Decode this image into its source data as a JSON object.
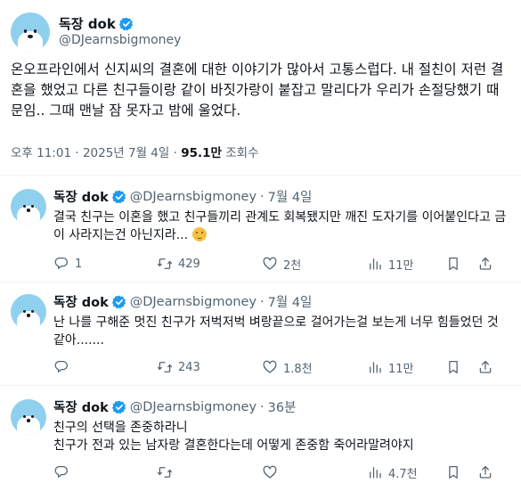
{
  "author": {
    "display_name": "독장 dok",
    "handle": "@DJearnsbigmoney"
  },
  "main_post": {
    "text": "온오프라인에서 신지씨의 결혼에 대한 이야기가 많아서 고통스럽다. 내 절친이 저런 결혼을 했었고 다른 친구들이랑 같이 바짓가랑이 붙잡고 말리다가 우리가 손절당했기 때문임.. 그때 맨날 잠 못자고 밤에 울었다.",
    "time": "오후 11:01",
    "date": "2025년 7월 4일",
    "views_count": "95.1만",
    "views_label": "조회수"
  },
  "replies": [
    {
      "name": "독장 dok",
      "handle": "@DJearnsbigmoney",
      "time": "7월 4일",
      "text": "결국 친구는 이혼을 했고 친구들끼리 관계도 회복됐지만 깨진 도자기를 이어붙인다고 금이 사라지는건 아닌지라...",
      "has_emoji": true,
      "replies": "1",
      "reposts": "429",
      "likes": "2천",
      "views": "11만"
    },
    {
      "name": "독장 dok",
      "handle": "@DJearnsbigmoney",
      "time": "7월 4일",
      "text": "난 나를 구해준 멋진 친구가 저벅저벅 벼랑끝으로 걸어가는걸 보는게 너무 힘들었던 것 같아.......",
      "has_emoji": false,
      "replies": "",
      "reposts": "243",
      "likes": "1.8천",
      "views": "11만"
    },
    {
      "name": "독장 dok",
      "handle": "@DJearnsbigmoney",
      "time": "36분",
      "text_line1": "친구의 선택을 존중하라니",
      "text_line2": "친구가 전과 있는 남자랑 결혼한다는데 어떻게 존중함 죽어라말려야지",
      "has_emoji": false,
      "replies": "",
      "reposts": "",
      "likes": "",
      "views": "4.7천"
    }
  ],
  "colors": {
    "verified": "#1d9bf0",
    "text": "#0f1419",
    "muted": "#536471",
    "divider": "#eff3f4",
    "avatar_bg": "#8fd0ee"
  },
  "icons": [
    "reply-icon",
    "repost-icon",
    "like-icon",
    "views-icon",
    "bookmark-icon",
    "share-icon",
    "verified-badge-icon"
  ]
}
